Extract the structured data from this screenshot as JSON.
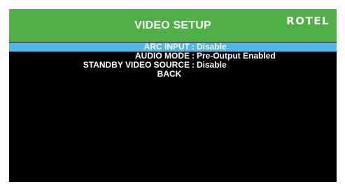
{
  "header": {
    "title": "VIDEO SETUP",
    "brand": "ROTEL"
  },
  "menu": {
    "items": [
      {
        "label": "ARC INPUT",
        "separator": ":",
        "value": "Disable",
        "selected": true
      },
      {
        "label": "AUDIO MODE",
        "separator": ":",
        "value": "Pre-Output Enabled",
        "selected": false
      },
      {
        "label": "STANDBY VIDEO SOURCE",
        "separator": ":",
        "value": "Disable",
        "selected": false
      }
    ],
    "back_label": "BACK"
  },
  "colors": {
    "header_bg": "#4fb046",
    "selected_bg": "#4fb6ea",
    "screen_bg": "#000000",
    "text": "#ffffff"
  }
}
